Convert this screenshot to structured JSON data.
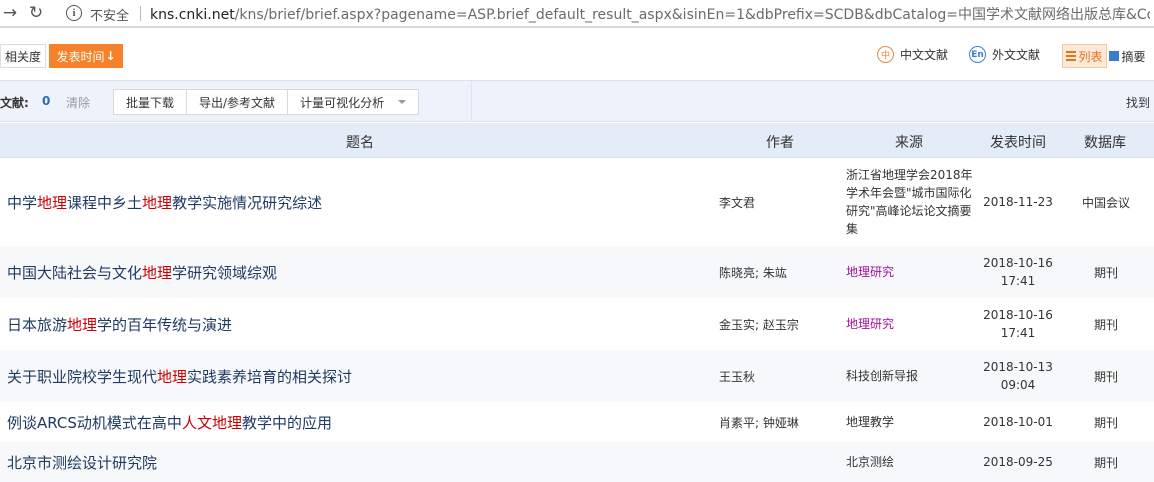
{
  "browser": {
    "insecure_label": "不安全",
    "url_host": "kns.cnki.net",
    "url_path": "/kns/brief/brief.aspx?pagename=ASP.brief_default_result_aspx&isinEn=1&dbPrefix=SCDB&dbCatalog=中国学术文献网络出版总库&Conf..."
  },
  "sort": {
    "relevance": "相关度",
    "pubdate": "发表时间",
    "chinese_docs": "中文文献",
    "foreign_docs": "外文文献",
    "view_list": "列表",
    "view_abstract": "摘要"
  },
  "selection": {
    "label": "文献:",
    "count": "0",
    "clear": "清除",
    "actions": [
      "批量下载",
      "导出/参考文献",
      "计量可视化分析"
    ],
    "found": "找到"
  },
  "table": {
    "headers": {
      "title": "题名",
      "author": "作者",
      "source": "来源",
      "date": "发表时间",
      "db": "数据库"
    },
    "rows": [
      {
        "title_parts": [
          "中学",
          "地理",
          "课程中乡土",
          "地理",
          "教学实施情况研究综述"
        ],
        "author": "李文君",
        "source_lines": [
          "浙江省地理学会2018年",
          "学术年会暨\"城市国际化",
          "研究\"高峰论坛论文摘要",
          "集"
        ],
        "date_lines": [
          "2018-11-23"
        ],
        "db": "中国会议"
      },
      {
        "title_parts": [
          "中国大陆社会与文化",
          "地理",
          "学研究领域综观"
        ],
        "author": "陈晓亮; 朱竑",
        "source_lines": [
          "地理研究"
        ],
        "date_lines": [
          "2018-10-16",
          "17:41"
        ],
        "db": "期刊"
      },
      {
        "title_parts": [
          "日本旅游",
          "地理",
          "学的百年传统与演进"
        ],
        "author": "金玉实; 赵玉宗",
        "source_lines": [
          "地理研究"
        ],
        "date_lines": [
          "2018-10-16",
          "17:41"
        ],
        "db": "期刊"
      },
      {
        "title_parts": [
          "关于职业院校学生现代",
          "地理",
          "实践素养培育的相关探讨"
        ],
        "author": "王玉秋",
        "source_lines": [
          "科技创新导报"
        ],
        "date_lines": [
          "2018-10-13",
          "09:04"
        ],
        "db": "期刊"
      },
      {
        "title_parts": [
          "例谈ARCS动机模式在高中",
          "人文地理",
          "教学中的应用"
        ],
        "author": "肖素平; 钟娅琳",
        "source_lines": [
          "地理教学"
        ],
        "date_lines": [
          "2018-10-01"
        ],
        "db": "期刊"
      },
      {
        "title_parts": [
          "北京市测绘设计研究院"
        ],
        "author": "",
        "source_lines": [
          "北京测绘"
        ],
        "date_lines": [
          "2018-09-25"
        ],
        "db": "期刊"
      }
    ]
  }
}
